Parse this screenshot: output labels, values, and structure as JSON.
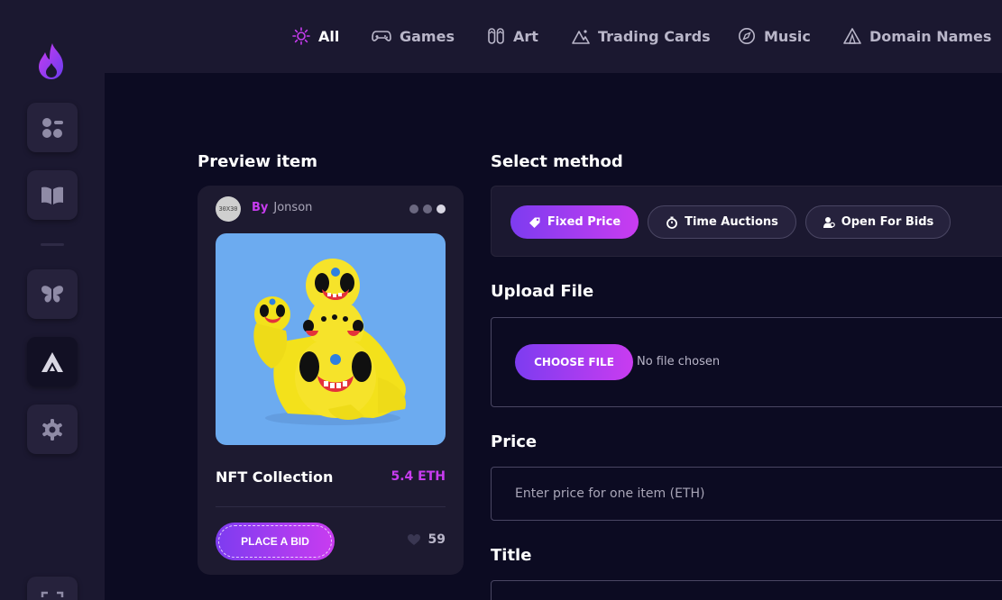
{
  "nav": {
    "items": [
      {
        "label": "All",
        "icon": "sun-icon"
      },
      {
        "label": "Games",
        "icon": "gamepad-icon"
      },
      {
        "label": "Art",
        "icon": "flip-flops-icon"
      },
      {
        "label": "Trading Cards",
        "icon": "mountains-icon"
      },
      {
        "label": "Music",
        "icon": "compass-icon"
      },
      {
        "label": "Domain Names",
        "icon": "tent-icon"
      }
    ],
    "active": "All"
  },
  "sidebar": {
    "items": [
      "flame-logo",
      "dashboard-icon",
      "book-icon",
      "butterfly-icon",
      "brand-a-icon",
      "gear-icon",
      "scan-icon"
    ]
  },
  "preview": {
    "heading": "Preview item",
    "avatar_text": "30X30",
    "by_label": "By",
    "author": "Jonson",
    "nft_name": "NFT Collection",
    "price": "5.4 ETH",
    "bid_label": "PLACE A BID",
    "likes": "59"
  },
  "method": {
    "heading": "Select method",
    "options": [
      "Fixed Price",
      "Time Auctions",
      "Open For Bids"
    ],
    "selected": "Fixed Price"
  },
  "upload": {
    "heading": "Upload File",
    "button_label": "CHOOSE FILE",
    "status": "No file chosen"
  },
  "price_field": {
    "heading": "Price",
    "placeholder": "Enter price for one item (ETH)"
  },
  "title_field": {
    "heading": "Title"
  },
  "colors": {
    "accent_start": "#7d3cf0",
    "accent_end": "#c93cf0",
    "background": "#0c0b22",
    "panel": "#1b1830"
  }
}
